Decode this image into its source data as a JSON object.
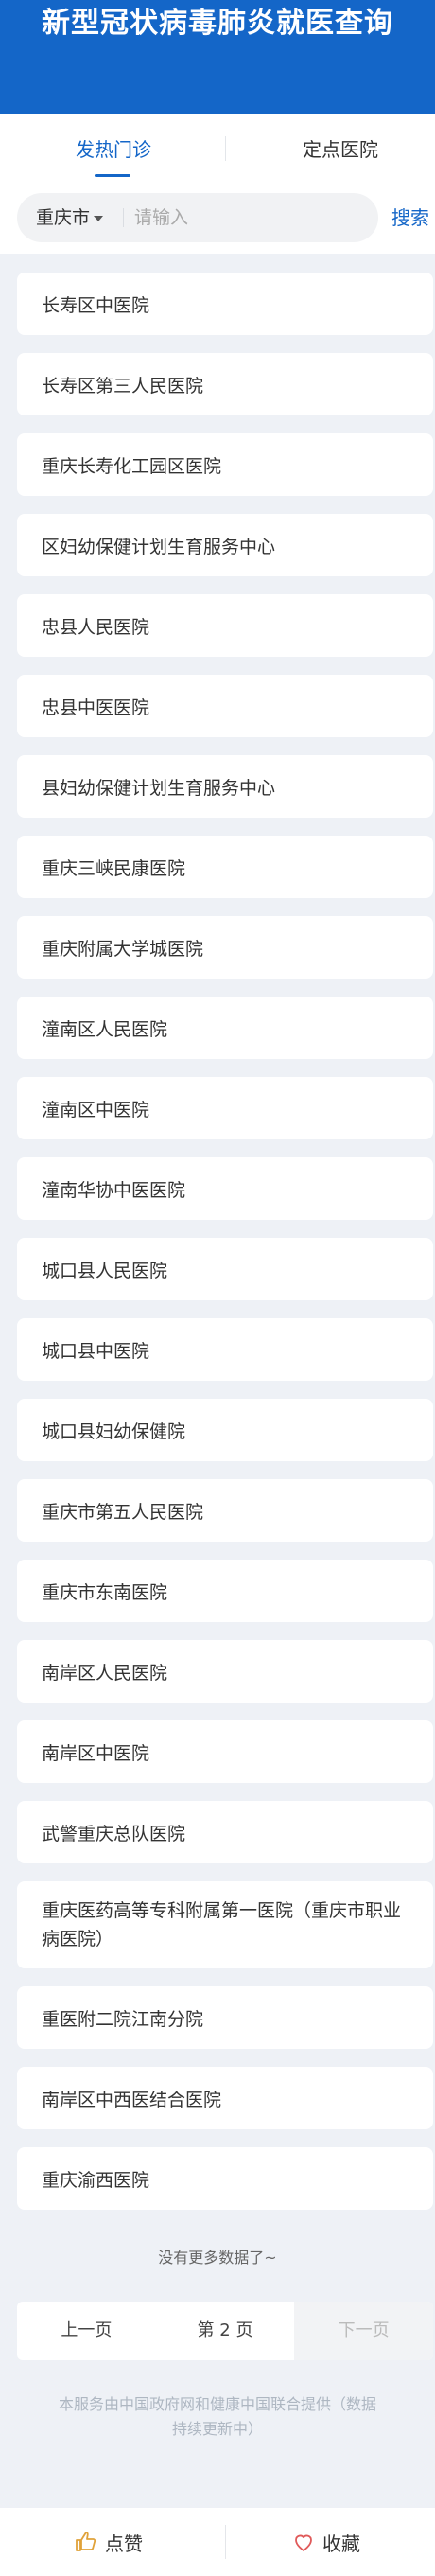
{
  "header": {
    "title": "新型冠状病毒肺炎就医查询"
  },
  "tabs": [
    {
      "label": "发热门诊",
      "active": true
    },
    {
      "label": "定点医院",
      "active": false
    }
  ],
  "search": {
    "city": "重庆市",
    "placeholder": "请输入",
    "button_label": "搜索"
  },
  "hospitals": [
    "长寿区中医院",
    "长寿区第三人民医院",
    "重庆长寿化工园区医院",
    "区妇幼保健计划生育服务中心",
    "忠县人民医院",
    "忠县中医医院",
    "县妇幼保健计划生育服务中心",
    "重庆三峡民康医院",
    "重庆附属大学城医院",
    "潼南区人民医院",
    "潼南区中医院",
    "潼南华协中医医院",
    "城口县人民医院",
    "城口县中医院",
    "城口县妇幼保健院",
    "重庆市第五人民医院",
    "重庆市东南医院",
    "南岸区人民医院",
    "南岸区中医院",
    "武警重庆总队医院",
    "重庆医药高等专科附属第一医院（重庆市职业病医院）",
    "重医附二院江南分院",
    "南岸区中西医结合医院",
    "重庆渝西医院"
  ],
  "no_more_text": "没有更多数据了~",
  "pagination": {
    "prev_label": "上一页",
    "current_label": "第 2 页",
    "next_label": "下一页"
  },
  "footer_note": "本服务由中国政府网和健康中国联合提供（数据持续更新中）",
  "bottom_bar": {
    "like_label": "点赞",
    "favorite_label": "收藏",
    "accent_color": "#e0a23a",
    "favorite_color": "#e05a5a"
  },
  "colors": {
    "primary": "#1466c8",
    "background": "#eef1f6"
  }
}
